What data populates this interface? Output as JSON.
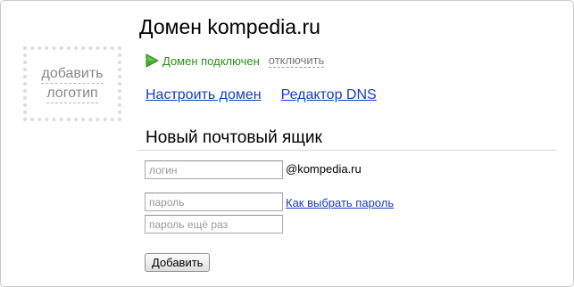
{
  "logo_placeholder": {
    "line1": "добавить",
    "line2": "логотип"
  },
  "domain": {
    "title": "Домен kompedia.ru",
    "status": "Домен подключен",
    "disconnect": "отключить",
    "status_icon": "play-icon",
    "status_color": "#2a8f1c"
  },
  "links": {
    "configure": "Настроить домен",
    "dns_editor": "Редактор DNS",
    "color": "#1a3dc1"
  },
  "mailbox_form": {
    "title": "Новый почтовый ящик",
    "login_placeholder": "логин",
    "login_value": "",
    "domain_suffix": "@kompedia.ru",
    "password_placeholder": "пароль",
    "password_value": "",
    "password_hint_link": "Как выбрать пароль",
    "password_repeat_placeholder": "пароль ещё раз",
    "password_repeat_value": "",
    "submit_label": "Добавить"
  }
}
